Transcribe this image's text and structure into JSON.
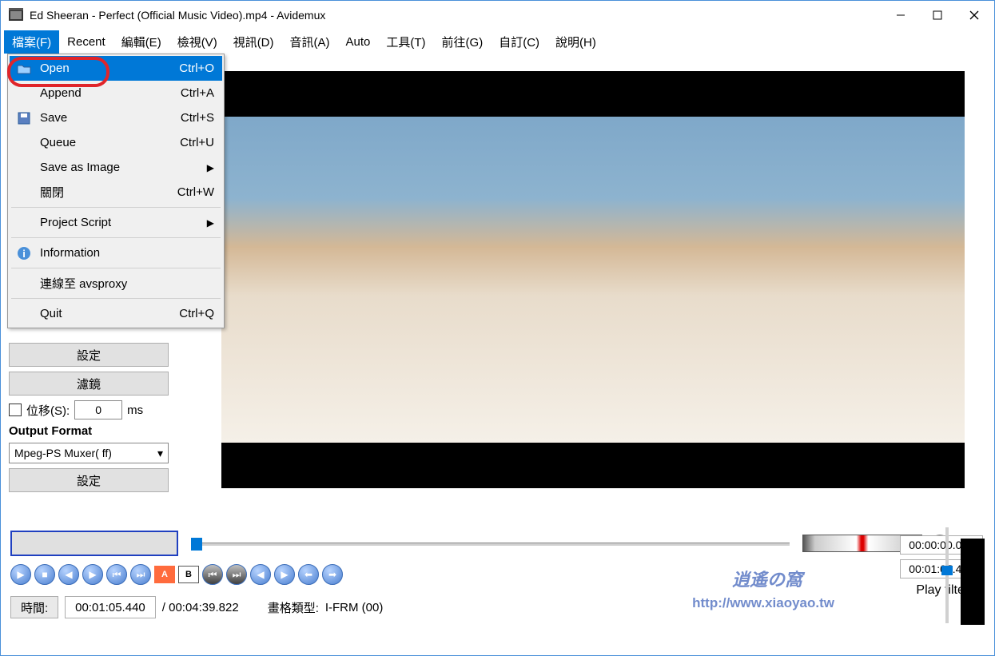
{
  "window": {
    "title": "Ed Sheeran - Perfect (Official Music Video).mp4 - Avidemux"
  },
  "menubar": {
    "items": [
      "檔案(F)",
      "Recent",
      "編輯(E)",
      "檢視(V)",
      "視訊(D)",
      "音訊(A)",
      "Auto",
      "工具(T)",
      "前往(G)",
      "自訂(C)",
      "說明(H)"
    ]
  },
  "file_menu": {
    "open": {
      "label": "Open",
      "shortcut": "Ctrl+O"
    },
    "append": {
      "label": "Append",
      "shortcut": "Ctrl+A"
    },
    "save": {
      "label": "Save",
      "shortcut": "Ctrl+S"
    },
    "queue": {
      "label": "Queue",
      "shortcut": "Ctrl+U"
    },
    "save_as_image": {
      "label": "Save as Image"
    },
    "close": {
      "label": "關閉",
      "shortcut": "Ctrl+W"
    },
    "project_script": {
      "label": "Project Script"
    },
    "information": {
      "label": "Information"
    },
    "avsproxy": {
      "label": "連線至 avsproxy"
    },
    "quit": {
      "label": "Quit",
      "shortcut": "Ctrl+Q"
    }
  },
  "sidebar": {
    "configure1": "設定",
    "filters": "濾鏡",
    "shift_label": "位移(S):",
    "shift_value": "0",
    "shift_unit": "ms",
    "output_format": "Output Format",
    "format_value": "Mpeg-PS Muxer( ff)",
    "configure2": "設定"
  },
  "bottom": {
    "time_label": "時間:",
    "time_value": "00:01:05.440",
    "duration": "/ 00:04:39.822",
    "frame_type_label": "畫格類型:",
    "frame_type_value": "I-FRM (00)",
    "sel_a": "00:00:00.041",
    "sel_b": "00:01:05.440",
    "play_filtered": "Play filtered"
  },
  "watermark": {
    "main": "逍遙の窩",
    "url": "http://www.xiaoyao.tw"
  }
}
